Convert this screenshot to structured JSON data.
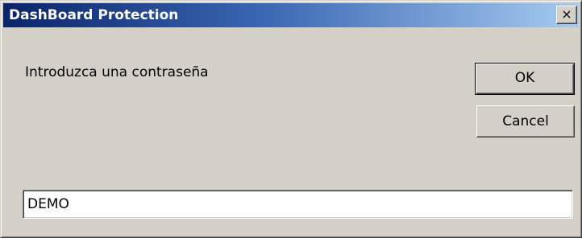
{
  "window": {
    "title": "DashBoard Protection",
    "close_label": "×",
    "close_icon": "close-icon"
  },
  "dialog": {
    "prompt": "Introduzca una contraseña",
    "ok_label": "OK",
    "cancel_label": "Cancel",
    "password_value": "DEMO"
  },
  "colors": {
    "title_gradient_start": "#0a246a",
    "title_gradient_end": "#a6caf0",
    "dialog_background": "#d4d0c8"
  }
}
